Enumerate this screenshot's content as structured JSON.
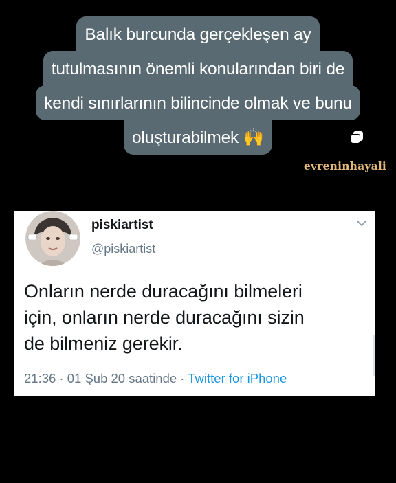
{
  "story": {
    "caption_lines": [
      "Balık burcunda gerçekleşen ay",
      "tutulmasının önemli konularından biri de",
      "kendi sınırlarının bilincinde olmak ve bunu",
      "oluşturabilmek 🙌"
    ],
    "watermark": "evreninhayali",
    "caption_bg": "#5a6a72",
    "watermark_color": "#e2b97a"
  },
  "tweet": {
    "author_name": "piskiartist",
    "author_handle": "@piskiartist",
    "body_lines": [
      "Onların nerde duracağını bilmeleri",
      "için, onların nerde duracağını sizin",
      "de bilmeniz gerekir."
    ],
    "timestamp": "21:36 · 01 Şub 20 saatinde · ",
    "source": "Twitter for iPhone",
    "source_color": "#1b95e0"
  }
}
